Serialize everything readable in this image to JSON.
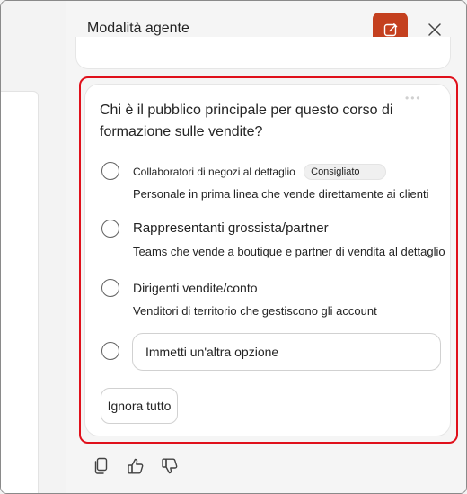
{
  "pane": {
    "title": "Modalità agente",
    "new_chat_icon": "edit-icon",
    "close_icon": "close-icon"
  },
  "question": {
    "text": "Chi è il pubblico principale per questo corso di formazione sulle vendite?",
    "options": [
      {
        "title": "Collaboratori di negozi al dettaglio",
        "badge": "Consigliato",
        "description": "Personale in prima linea che vende direttamente ai clienti"
      },
      {
        "title": "Rappresentanti grossista/partner",
        "description": "Teams che vende a boutique e partner di vendita al dettaglio"
      },
      {
        "title": "Dirigenti vendite/conto",
        "description": "Venditori di territorio che gestiscono gli account"
      }
    ],
    "other_placeholder": "Immetti un'altra opzione",
    "ignore_all_label": "Ignora tutto"
  },
  "response_actions": [
    "copy-icon",
    "thumbs-up-icon",
    "thumbs-down-icon"
  ],
  "colors": {
    "accent": "#c4401f",
    "highlight_border": "#e0101b"
  }
}
